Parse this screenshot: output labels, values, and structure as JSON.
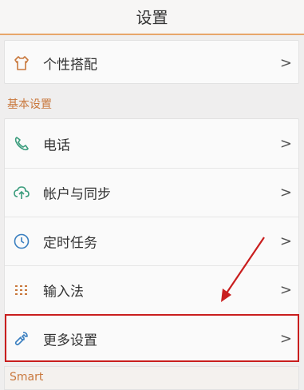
{
  "header": {
    "title": "设置"
  },
  "personalization": {
    "label": "个性搭配",
    "chevron": ">"
  },
  "basic_section": {
    "title": "基本设置",
    "items": [
      {
        "label": "电话",
        "chevron": ">"
      },
      {
        "label": "帐户与同步",
        "chevron": ">"
      },
      {
        "label": "定时任务",
        "chevron": ">"
      },
      {
        "label": "输入法",
        "chevron": ">"
      },
      {
        "label": "更多设置",
        "chevron": ">"
      }
    ]
  },
  "smart_section": {
    "title": "Smart"
  },
  "colors": {
    "accent_orange": "#e7a66a",
    "icon_orange": "#c9783d",
    "icon_green": "#3a9c7c",
    "annotation_red": "#c91e1e"
  },
  "icons": [
    "shirt-icon",
    "phone-icon",
    "cloud-sync-icon",
    "clock-icon",
    "keypad-icon",
    "wrench-icon"
  ]
}
